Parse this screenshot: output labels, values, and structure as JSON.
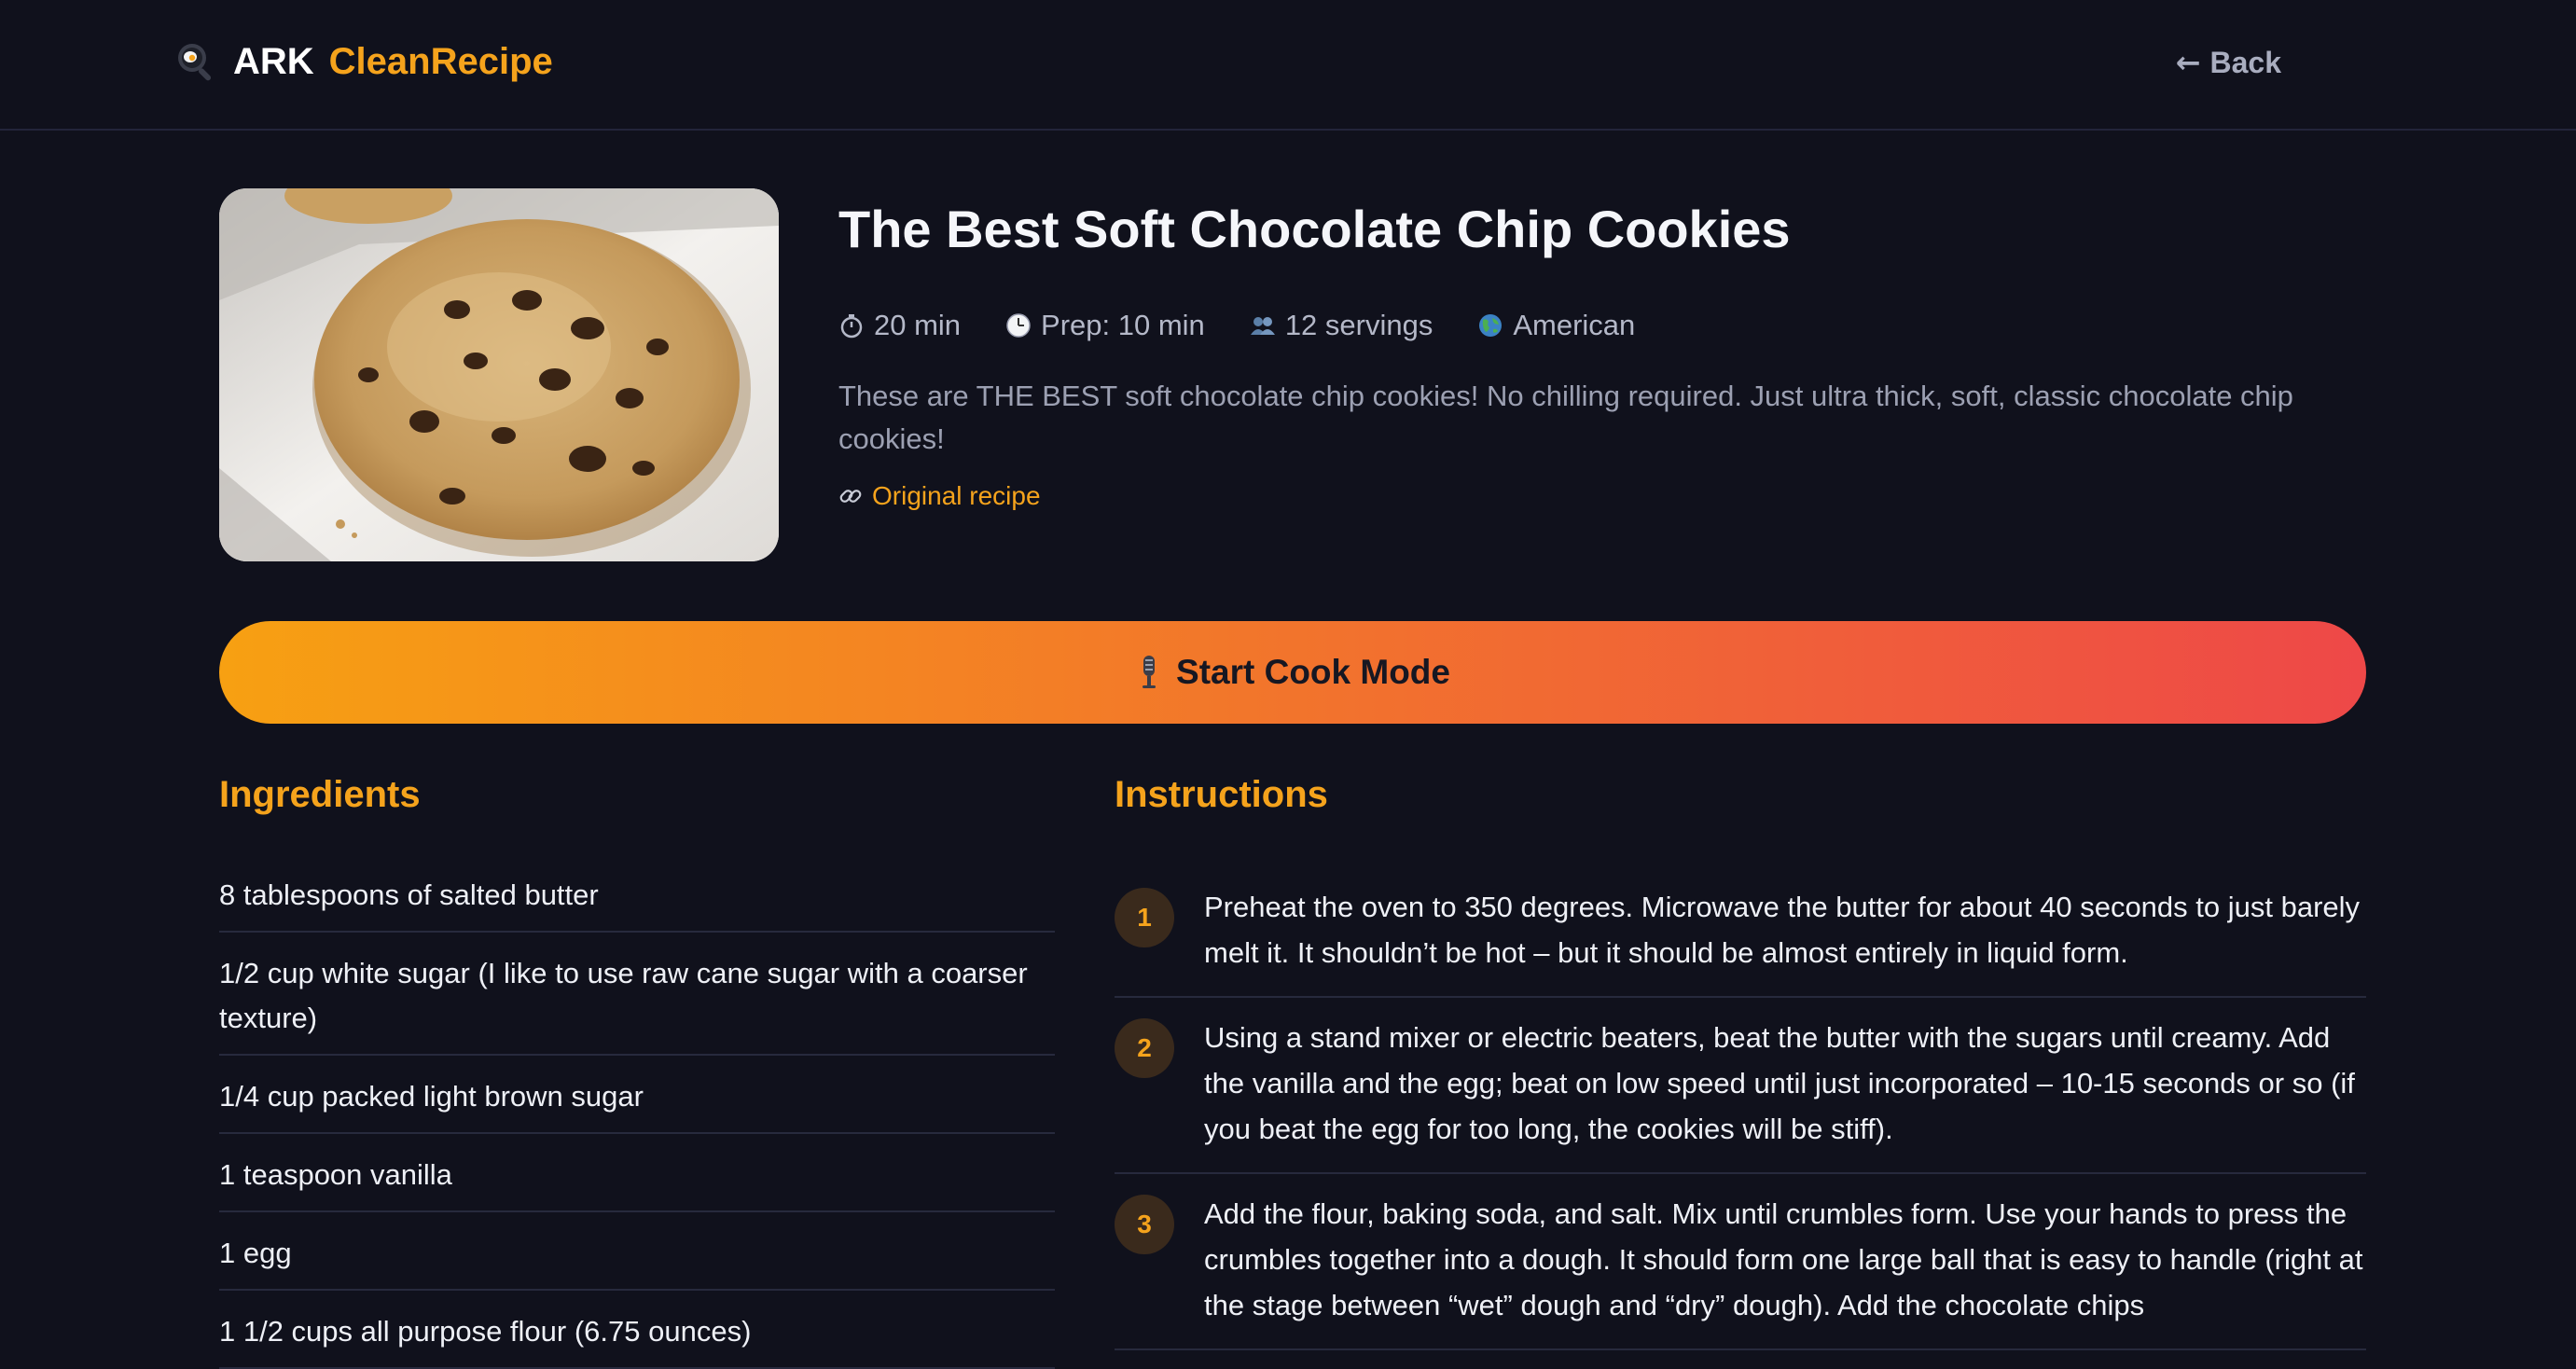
{
  "header": {
    "brand_ark": "ARK",
    "brand_name": "CleanRecipe",
    "brand_icon": "frying-pan-icon",
    "back_label": "Back",
    "back_icon": "arrow-left-icon"
  },
  "recipe": {
    "title": "The Best Soft Chocolate Chip Cookies",
    "image_alt": "chocolate chip cookie",
    "meta": {
      "total_time": "20 min",
      "prep_time": "Prep: 10 min",
      "servings": "12 servings",
      "cuisine": "American"
    },
    "description": "These are THE BEST soft chocolate chip cookies! No chilling required. Just ultra thick, soft, classic chocolate chip cookies!",
    "source_label": "Original recipe"
  },
  "cook_mode": {
    "label": "Start Cook Mode",
    "icon": "microphone-icon"
  },
  "ingredients": {
    "heading": "Ingredients",
    "items": [
      "8 tablespoons of salted butter",
      "1/2 cup white sugar (I like to use raw cane sugar with a coarser texture)",
      "1/4 cup packed light brown sugar",
      "1 teaspoon vanilla",
      "1 egg",
      "1 1/2 cups all purpose flour (6.75 ounces)"
    ]
  },
  "instructions": {
    "heading": "Instructions",
    "steps": [
      {
        "number": "1",
        "text": "Preheat the oven to 350 degrees. Microwave the butter for about 40 seconds to just barely melt it. It shouldn’t be hot – but it should be almost entirely in liquid form."
      },
      {
        "number": "2",
        "text": "Using a stand mixer or electric beaters, beat the butter with the sugars until creamy. Add the vanilla and the egg; beat on low speed until just incorporated – 10-15 seconds or so (if you beat the egg for too long, the cookies will be stiff)."
      },
      {
        "number": "3",
        "text": "Add the flour, baking soda, and salt. Mix until crumbles form. Use your hands to press the crumbles together into a dough. It should form one large ball that is easy to handle (right at the stage between “wet” dough and “dry” dough). Add the chocolate chips"
      }
    ]
  },
  "colors": {
    "background": "#10111c",
    "accent": "#f5a31c",
    "gradient_start": "#f7a012",
    "gradient_end": "#ee4848"
  }
}
